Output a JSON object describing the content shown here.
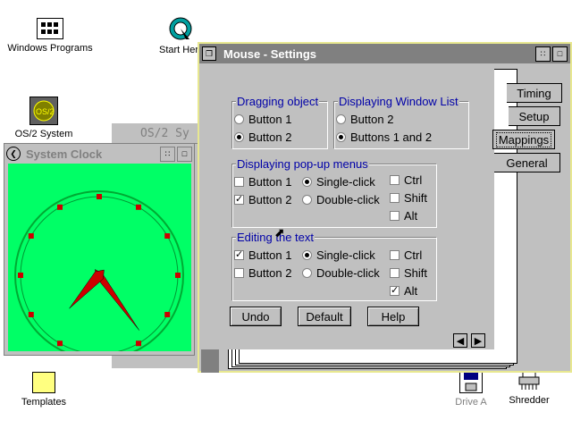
{
  "desktop": {
    "icons": [
      {
        "label": "Windows Programs"
      },
      {
        "label": "Start Here"
      },
      {
        "label": "OS/2 System"
      },
      {
        "label": "Templates"
      },
      {
        "label": "Drive A"
      },
      {
        "label": "Shredder"
      }
    ]
  },
  "os2_window": {
    "title": "OS/2 Sy"
  },
  "clock_window": {
    "title": "System Clock",
    "time": {
      "hour": 7,
      "minute": 24
    }
  },
  "mouse_window": {
    "title": "Mouse - Settings",
    "tabs": [
      "Timing",
      "Setup",
      "Mappings",
      "General"
    ],
    "active_tab": "Mappings",
    "groups": {
      "dragging": {
        "legend": "Dragging object",
        "options": [
          {
            "label": "Button 1",
            "selected": false
          },
          {
            "label": "Button 2",
            "selected": true
          }
        ]
      },
      "window_list": {
        "legend": "Displaying Window List",
        "options": [
          {
            "label": "Button 2",
            "selected": false
          },
          {
            "label": "Buttons 1 and 2",
            "selected": true
          }
        ]
      },
      "popup": {
        "legend": "Displaying pop-up menus",
        "buttons": [
          {
            "label": "Button 1",
            "checked": false
          },
          {
            "label": "Button 2",
            "checked": true
          }
        ],
        "clicks": [
          {
            "label": "Single-click",
            "selected": true
          },
          {
            "label": "Double-click",
            "selected": false
          }
        ],
        "keys": [
          {
            "label": "Ctrl",
            "checked": false
          },
          {
            "label": "Shift",
            "checked": false
          },
          {
            "label": "Alt",
            "checked": false
          }
        ]
      },
      "edit_text": {
        "legend": "Editing the text",
        "buttons": [
          {
            "label": "Button 1",
            "checked": true
          },
          {
            "label": "Button 2",
            "checked": false
          }
        ],
        "clicks": [
          {
            "label": "Single-click",
            "selected": true
          },
          {
            "label": "Double-click",
            "selected": false
          }
        ],
        "keys": [
          {
            "label": "Ctrl",
            "checked": false
          },
          {
            "label": "Shift",
            "checked": false
          },
          {
            "label": "Alt",
            "checked": true
          }
        ]
      }
    },
    "buttons": {
      "undo": "Undo",
      "default": "Default",
      "help": "Help"
    }
  },
  "colors": {
    "clock_face": "#00ff66",
    "hand": "#cc0000",
    "title_active": "#808080",
    "legend": "#0000a8"
  }
}
